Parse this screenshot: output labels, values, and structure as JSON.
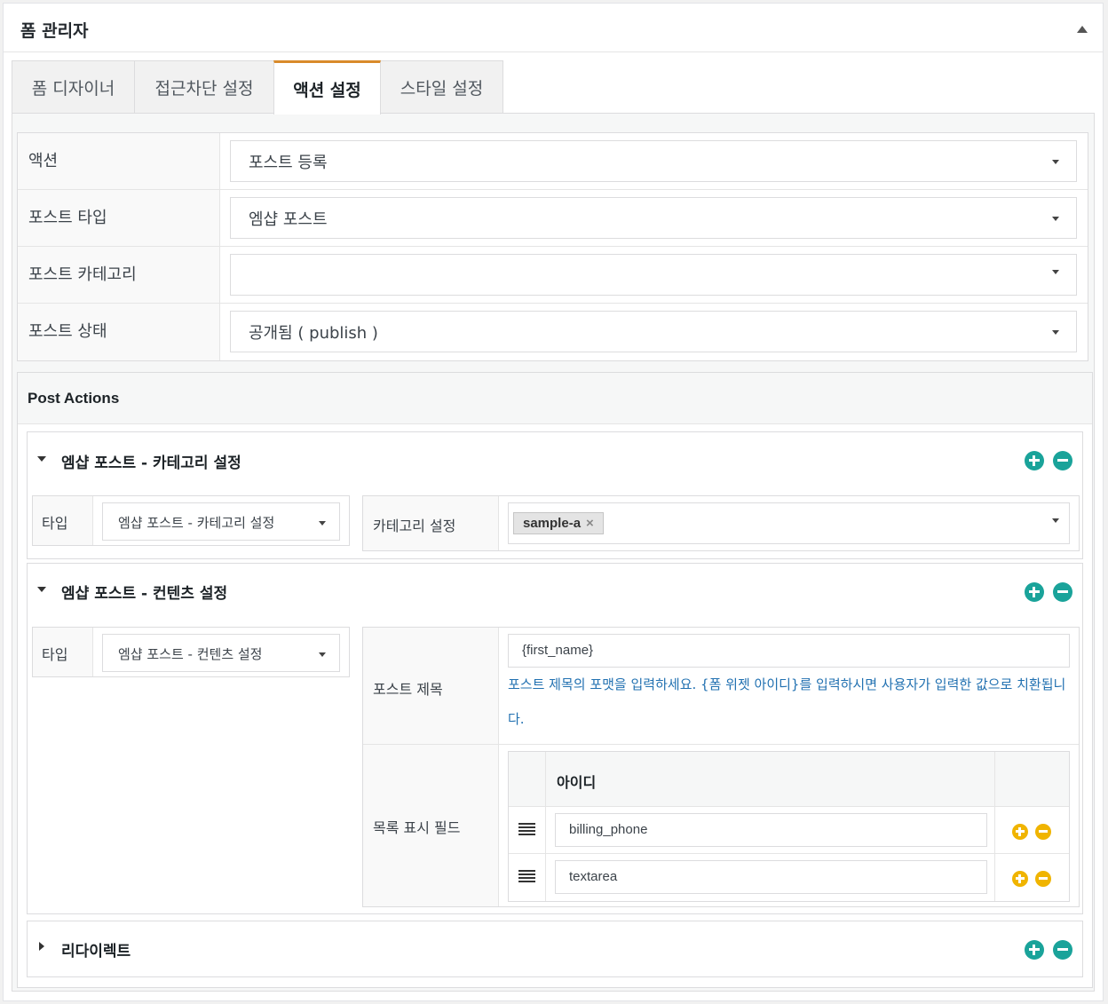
{
  "header": {
    "title": "폼 관리자"
  },
  "tabs": [
    {
      "label": "폼 디자이너"
    },
    {
      "label": "접근차단 설정"
    },
    {
      "label": "액션 설정"
    },
    {
      "label": "스타일 설정"
    }
  ],
  "settings": {
    "action_label": "액션",
    "action_value": "포스트 등록",
    "post_type_label": "포스트 타입",
    "post_type_value": "엠샵 포스트",
    "post_category_label": "포스트 카테고리",
    "post_category_value": "",
    "post_status_label": "포스트 상태",
    "post_status_value": "공개됨 ( publish )"
  },
  "post_actions": {
    "title": "Post Actions",
    "category_box": {
      "title": "엠샵 포스트 - 카테고리 설정",
      "type_label": "타입",
      "type_value": "엠샵 포스트 - 카테고리 설정",
      "category_label": "카테고리 설정",
      "tag": "sample-a",
      "tag_remove": "×"
    },
    "content_box": {
      "title": "엠샵 포스트 - 컨텐츠 설정",
      "type_label": "타입",
      "type_value": "엠샵 포스트 - 컨텐츠 설정",
      "post_title_label": "포스트 제목",
      "post_title_value": "{first_name}",
      "post_title_hint": "포스트 제목의 포맷을 입력하세요. {폼 위젯 아이디}를 입력하시면 사용자가 입력한 값으로 치환됩니다.",
      "list_fields_label": "목록 표시 필드",
      "list_header": "아이디",
      "list_rows": [
        "billing_phone",
        "textarea"
      ]
    },
    "redirect_box": {
      "title": "리다이렉트"
    }
  },
  "colors": {
    "accent_tab": "#d98a2b",
    "teal_button": "#1aa39a",
    "yellow_button": "#f0b400",
    "hint_text": "#2271b1"
  },
  "icons": [
    "collapse-up-icon",
    "dropdown-caret-icon",
    "expand-triangle-icon",
    "add-circle-icon",
    "remove-circle-icon",
    "drag-handle-icon",
    "tag-remove-icon"
  ]
}
